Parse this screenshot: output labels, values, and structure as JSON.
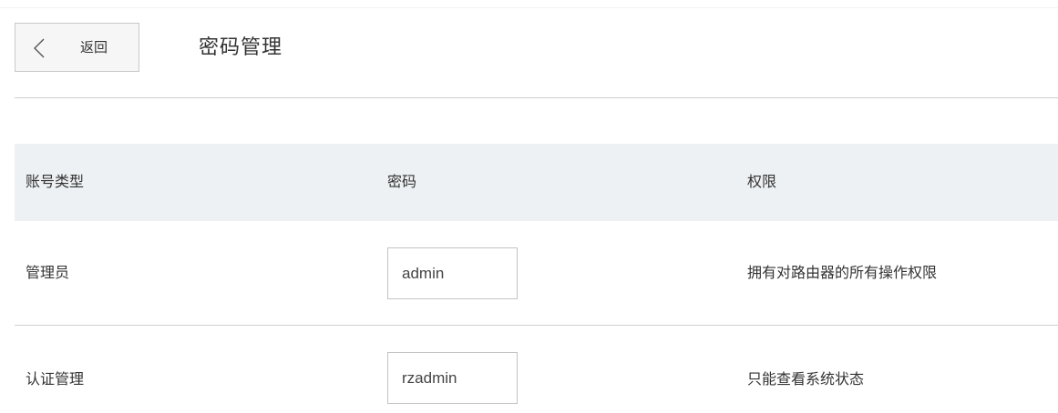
{
  "header": {
    "back_label": "返回",
    "title": "密码管理"
  },
  "table": {
    "columns": [
      "账号类型",
      "密码",
      "权限"
    ],
    "rows": [
      {
        "account_type": "管理员",
        "password": "admin",
        "permission": "拥有对路由器的所有操作权限"
      },
      {
        "account_type": "认证管理",
        "password": "rzadmin",
        "permission": "只能查看系统状态"
      }
    ]
  },
  "colors": {
    "header_bg": "#eef1f3",
    "divider": "#cfcfcf",
    "back_button_bg": "#f6f6f6"
  },
  "icons": {
    "back": "chevron-left-icon"
  }
}
